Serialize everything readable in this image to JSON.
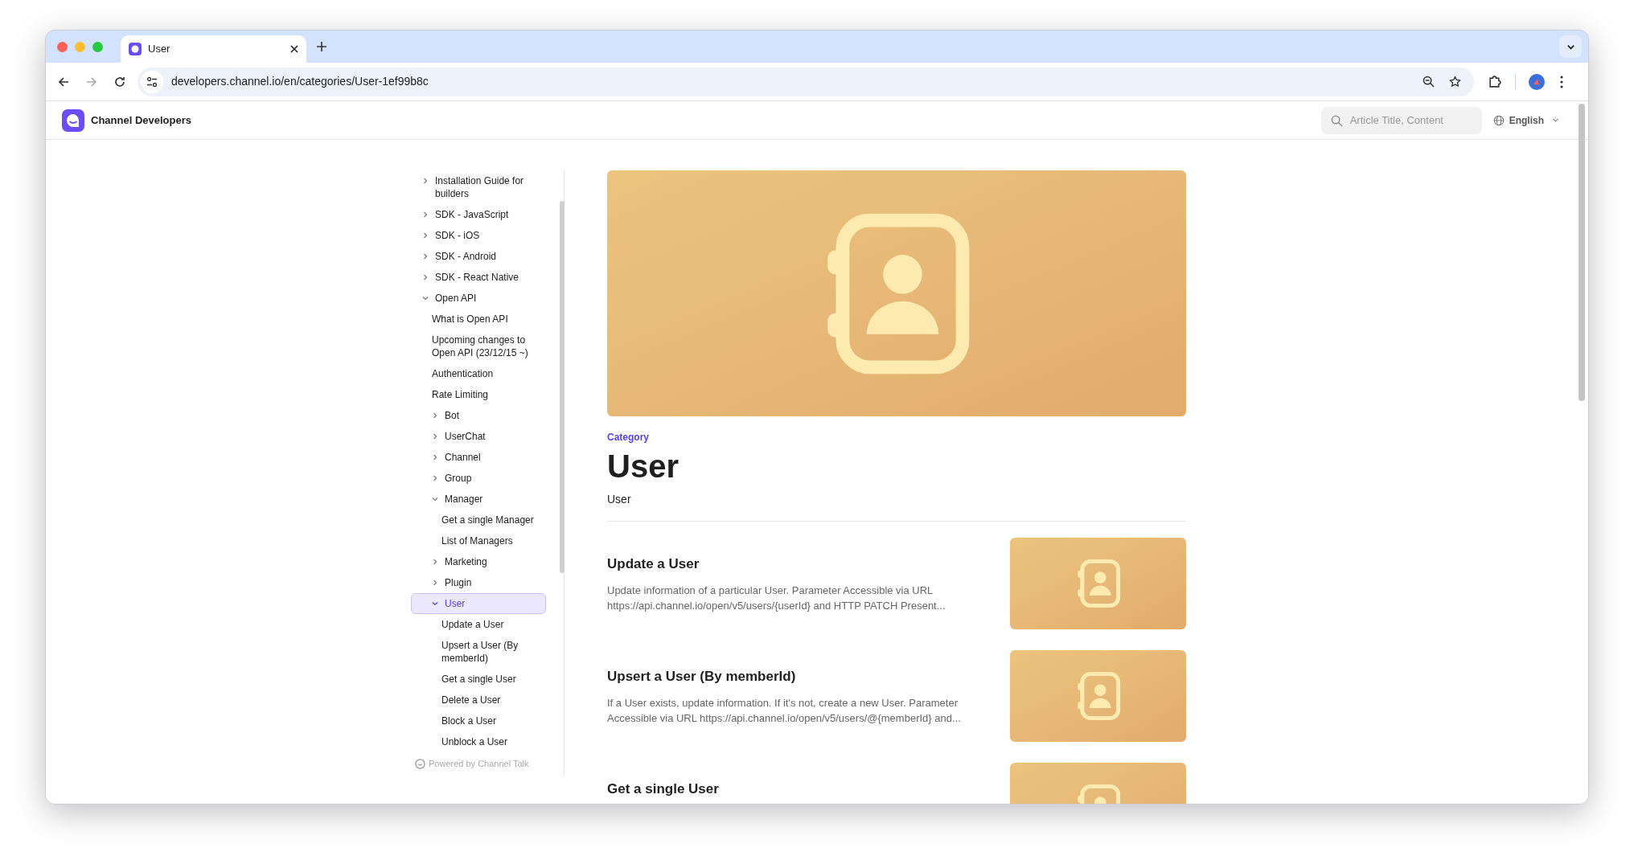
{
  "browser": {
    "tabs": [
      {
        "title": "User",
        "selected": true
      }
    ],
    "url": "developers.channel.io/en/categories/User-1ef99b8c"
  },
  "header": {
    "brand": "Channel Developers",
    "search": {
      "placeholder": "Article Title, Content"
    },
    "language": "English"
  },
  "sidebar": {
    "items": [
      {
        "label": "Installation Guide for builders",
        "expanded": false,
        "selected": false
      },
      {
        "label": "SDK - JavaScript",
        "expanded": false,
        "selected": false
      },
      {
        "label": "SDK - iOS",
        "expanded": false,
        "selected": false
      },
      {
        "label": "SDK - Android",
        "expanded": false,
        "selected": false
      },
      {
        "label": "SDK - React Native",
        "expanded": false,
        "selected": false
      },
      {
        "label": "Open API",
        "expanded": true,
        "selected": false,
        "children": [
          {
            "label": "What is Open API",
            "selected": false
          },
          {
            "label": "Upcoming changes to Open API (23/12/15 ~)",
            "selected": false
          },
          {
            "label": "Authentication",
            "selected": false
          },
          {
            "label": "Rate Limiting",
            "selected": false
          },
          {
            "label": "Bot",
            "expanded": false,
            "selected": false
          },
          {
            "label": "UserChat",
            "expanded": false,
            "selected": false
          },
          {
            "label": "Channel",
            "expanded": false,
            "selected": false
          },
          {
            "label": "Group",
            "expanded": false,
            "selected": false
          },
          {
            "label": "Manager",
            "expanded": true,
            "selected": false,
            "children": [
              {
                "label": "Get a single Manager",
                "selected": false
              },
              {
                "label": "List of Managers",
                "selected": false
              }
            ]
          },
          {
            "label": "Marketing",
            "expanded": false,
            "selected": false
          },
          {
            "label": "Plugin",
            "expanded": false,
            "selected": false
          },
          {
            "label": "User",
            "expanded": true,
            "selected": true,
            "children": [
              {
                "label": "Update a User",
                "selected": false
              },
              {
                "label": "Upsert a User (By memberId)",
                "selected": false
              },
              {
                "label": "Get a single User",
                "selected": false
              },
              {
                "label": "Delete a User",
                "selected": false
              },
              {
                "label": "Block a User",
                "selected": false
              },
              {
                "label": "Unblock a User",
                "selected": false
              }
            ]
          }
        ]
      }
    ],
    "footer": "Powered by Channel Talk"
  },
  "category": {
    "label": "Category",
    "title": "User",
    "description": "User"
  },
  "articles": [
    {
      "title": "Update a User",
      "summary": "Update information of a particular User. Parameter Accessible via URL https://api.channel.io/open/v5/users/{userId} and HTTP PATCH Present..."
    },
    {
      "title": "Upsert a User (By memberId)",
      "summary": "If a User exists, update information. If it's not, create a new User. Parameter Accessible via URL https://api.channel.io/open/v5/users/@{memberId} and..."
    },
    {
      "title": "Get a single User"
    }
  ]
}
